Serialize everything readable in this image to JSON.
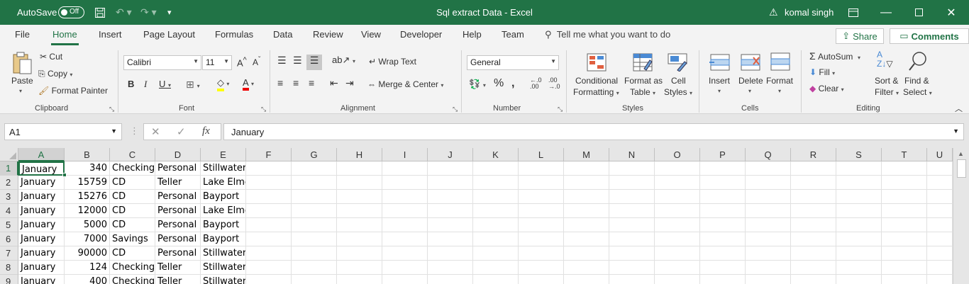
{
  "titlebar": {
    "autosave_label": "AutoSave",
    "autosave_state": "Off",
    "title": "Sql extract Data  -  Excel",
    "user": "komal singh"
  },
  "tabs": [
    "File",
    "Home",
    "Insert",
    "Page Layout",
    "Formulas",
    "Data",
    "Review",
    "View",
    "Developer",
    "Help",
    "Team"
  ],
  "active_tab": "Home",
  "tell_me": "Tell me what you want to do",
  "share_label": "Share",
  "comments_label": "Comments",
  "ribbon": {
    "clipboard": {
      "paste": "Paste",
      "cut": "Cut",
      "copy": "Copy",
      "format_painter": "Format Painter",
      "label": "Clipboard"
    },
    "font": {
      "name": "Calibri",
      "size": "11",
      "label": "Font"
    },
    "alignment": {
      "wrap_text": "Wrap Text",
      "merge_center": "Merge & Center",
      "label": "Alignment"
    },
    "number": {
      "format": "General",
      "label": "Number"
    },
    "styles": {
      "conditional_1": "Conditional",
      "conditional_2": "Formatting",
      "format_as_1": "Format as",
      "format_as_2": "Table",
      "cell_styles_1": "Cell",
      "cell_styles_2": "Styles",
      "label": "Styles"
    },
    "cells": {
      "insert": "Insert",
      "delete": "Delete",
      "format": "Format",
      "label": "Cells"
    },
    "editing": {
      "autosum": "AutoSum",
      "fill": "Fill",
      "clear": "Clear",
      "sort_1": "Sort &",
      "sort_2": "Filter",
      "find_1": "Find &",
      "find_2": "Select",
      "label": "Editing"
    }
  },
  "formula_bar": {
    "name_box": "A1",
    "content": "January"
  },
  "columns": [
    "A",
    "B",
    "C",
    "D",
    "E",
    "F",
    "G",
    "H",
    "I",
    "J",
    "K",
    "L",
    "M",
    "N",
    "O",
    "P",
    "Q",
    "R",
    "S",
    "T",
    "U"
  ],
  "rows": [
    {
      "n": "1",
      "a": "January",
      "b": "340",
      "c": "Checking",
      "d": "Personal E",
      "e": "Stillwater"
    },
    {
      "n": "2",
      "a": "January",
      "b": "15759",
      "c": "CD",
      "d": "Teller",
      "e": "Lake Elmo"
    },
    {
      "n": "3",
      "a": "January",
      "b": "15276",
      "c": "CD",
      "d": "Personal E",
      "e": "Bayport"
    },
    {
      "n": "4",
      "a": "January",
      "b": "12000",
      "c": "CD",
      "d": "Personal E",
      "e": "Lake Elmo"
    },
    {
      "n": "5",
      "a": "January",
      "b": "5000",
      "c": "CD",
      "d": "Personal E",
      "e": "Bayport"
    },
    {
      "n": "6",
      "a": "January",
      "b": "7000",
      "c": "Savings",
      "d": "Personal E",
      "e": "Bayport"
    },
    {
      "n": "7",
      "a": "January",
      "b": "90000",
      "c": "CD",
      "d": "Personal E",
      "e": "Stillwater"
    },
    {
      "n": "8",
      "a": "January",
      "b": "124",
      "c": "Checking",
      "d": "Teller",
      "e": "Stillwater"
    },
    {
      "n": "9",
      "a": "January",
      "b": "400",
      "c": "Checking",
      "d": "Teller",
      "e": "Stillwater"
    }
  ]
}
